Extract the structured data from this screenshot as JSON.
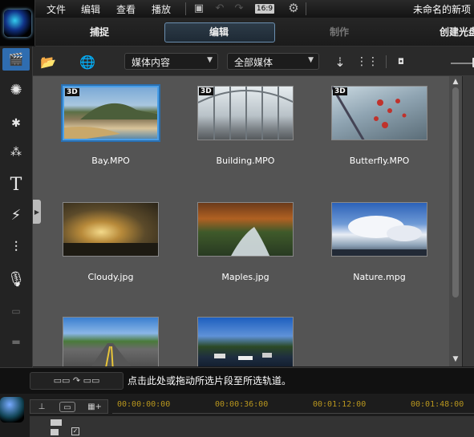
{
  "menu": {
    "items": [
      "文件",
      "编辑",
      "查看",
      "播放"
    ],
    "aspect_ratio": "16:9",
    "project_title": "未命名的新项"
  },
  "modes": {
    "capture": "捕捉",
    "edit": "编辑",
    "author": "制作",
    "create_disc": "创建光盘"
  },
  "content_toolbar": {
    "media_content_dropdown": "媒体内容",
    "all_media_dropdown": "全部媒体"
  },
  "library": {
    "items": [
      {
        "label": "Bay.MPO",
        "is_3d": true,
        "selected": true,
        "icon": "bay-image"
      },
      {
        "label": "Building.MPO",
        "is_3d": true,
        "selected": false,
        "icon": "building-image"
      },
      {
        "label": "Butterfly.MPO",
        "is_3d": true,
        "selected": false,
        "icon": "butterfly-image"
      },
      {
        "label": "Cloudy.jpg",
        "is_3d": false,
        "selected": false,
        "icon": "cloudy-image"
      },
      {
        "label": "Maples.jpg",
        "is_3d": false,
        "selected": false,
        "icon": "maples-image"
      },
      {
        "label": "Nature.mpg",
        "is_3d": false,
        "selected": false,
        "icon": "nature-image"
      },
      {
        "label": "",
        "is_3d": false,
        "selected": false,
        "icon": "road-image"
      },
      {
        "label": "",
        "is_3d": false,
        "selected": false,
        "icon": "harbor-image"
      }
    ],
    "badge_3d": "3D"
  },
  "timeline": {
    "hint": "点击此处或拖动所选片段至所选轨道。",
    "ruler_ticks": [
      "00:00:00:00",
      "00:00:36:00",
      "00:01:12:00",
      "00:01:48:00"
    ]
  },
  "colors": {
    "accent": "#2f6db0",
    "selection": "#4a9fe8",
    "timecode": "#b8961e",
    "library_bg": "#545454"
  }
}
